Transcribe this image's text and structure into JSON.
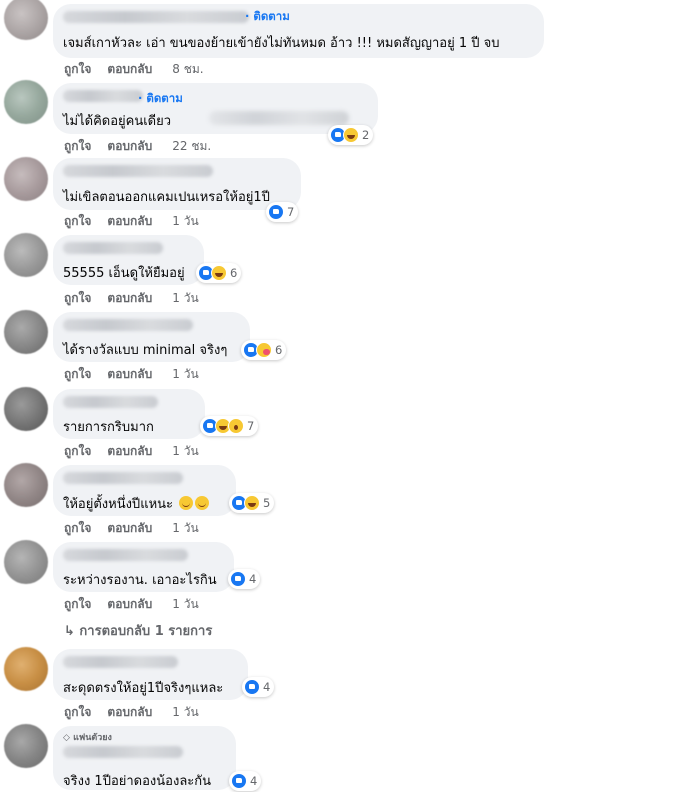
{
  "actions": {
    "like": "ถูกใจ",
    "reply": "ตอบกลับ"
  },
  "follow_label": "ติดตาม",
  "view_replies": "↳ การตอบกลับ 1 รายการ",
  "comments": [
    {
      "follow": "· ติดตาม",
      "text": "เจมส์เกาหัวละ เอ่า ขนของย้ายเข้ายังไม่ทันหมด อ้าว !!! หมดสัญญาอยู่ 1 ปี จบ",
      "time": "8 ชม.",
      "reactions": [],
      "count": ""
    },
    {
      "follow": "· ติดตาม",
      "text": "ไม่ได้คิดอยู่คนเดียว",
      "time": "22 ชม.",
      "reactions": [
        "like",
        "haha"
      ],
      "count": "2"
    },
    {
      "follow": "",
      "text": "ไม่เขิลตอนออกแคมเปนเหรอให้อยู่1ปี",
      "time": "1 วัน",
      "reactions": [
        "like"
      ],
      "count": "7"
    },
    {
      "follow": "",
      "text": "55555 เอ็นดูให้ยืมอยู่",
      "time": "1 วัน",
      "reactions": [
        "like",
        "haha"
      ],
      "count": "6"
    },
    {
      "follow": "",
      "text": "ได้รางวัลแบบ minimal จริงๆ",
      "time": "1 วัน",
      "reactions": [
        "like",
        "care"
      ],
      "count": "6"
    },
    {
      "follow": "",
      "text": "รายการกริบมาก",
      "time": "1 วัน",
      "reactions": [
        "like",
        "haha",
        "wow"
      ],
      "count": "7"
    },
    {
      "follow": "",
      "text": "ให้อยู่ตั้งหนึ่งปีแหนะ",
      "time": "1 วัน",
      "reactions": [
        "like",
        "haha"
      ],
      "count": "5"
    },
    {
      "follow": "",
      "text": "ระหว่างรองาน. เอาอะไรกิน",
      "time": "1 วัน",
      "reactions": [
        "like"
      ],
      "count": "4"
    },
    {
      "follow": "",
      "text": "สะดุดตรงให้อยู่1ปีจริงๆแหละ",
      "time": "1 วัน",
      "reactions": [
        "like"
      ],
      "count": "4"
    },
    {
      "follow": "",
      "badge": "แฟนตัวยง",
      "text": "จริงง 1ปีอย่าดองน้องละกัน",
      "time": "",
      "reactions": [
        "like"
      ],
      "count": "4"
    }
  ]
}
